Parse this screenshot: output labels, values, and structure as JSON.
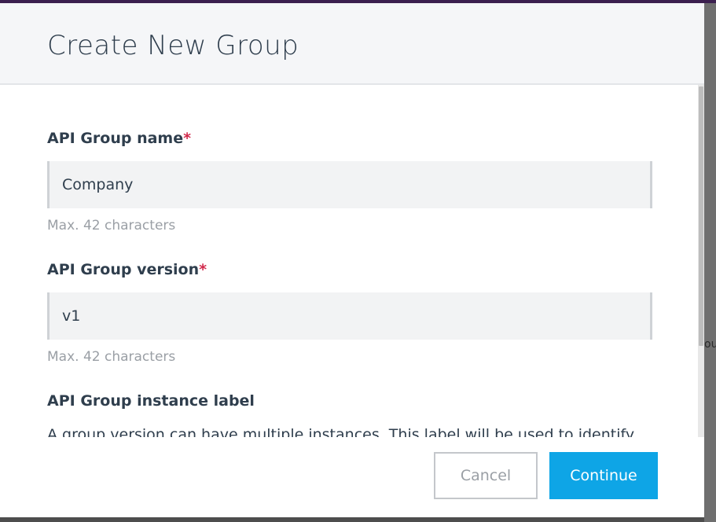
{
  "dialog": {
    "title": "Create New Group",
    "fields": {
      "name": {
        "label": "API Group name",
        "required_mark": "*",
        "value": "Company",
        "hint": "Max. 42 characters"
      },
      "version": {
        "label": "API Group version",
        "required_mark": "*",
        "value": "v1",
        "hint": "Max. 42 characters"
      },
      "instance_label": {
        "label": "API Group instance label",
        "description": "A group version can have multiple instances. This label will be used to identify"
      }
    },
    "buttons": {
      "cancel": "Cancel",
      "continue": "Continue"
    }
  },
  "backdrop": {
    "partial_text": "ou"
  },
  "colors": {
    "accent": "#0ea5e6",
    "required": "#d1294b",
    "title_text": "#2f3e4d",
    "hint_text": "#9a9fa5"
  }
}
